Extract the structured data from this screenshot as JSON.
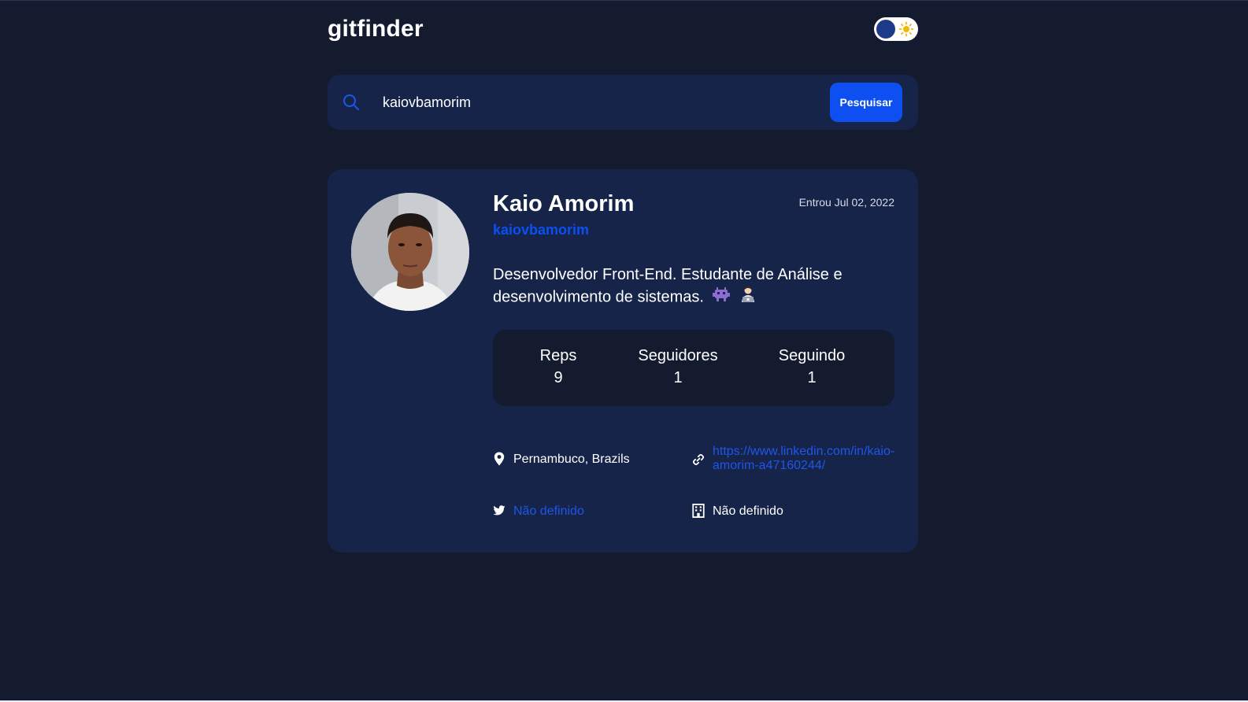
{
  "header": {
    "logo": "gitfinder",
    "theme_toggle": {
      "state": "dark",
      "knob_icon": "moon-knob",
      "sun_icon": "sun-icon"
    }
  },
  "search": {
    "icon": "search-icon",
    "value": "kaiovbamorim",
    "button_label": "Pesquisar"
  },
  "profile": {
    "avatar": "avatar-photo",
    "name": "Kaio Amorim",
    "login": "kaiovbamorim",
    "joined": "Entrou Jul 02, 2022",
    "bio_text": "Desenvolvedor Front-End. Estudante de Análise e desenvolvimento de sistemas.",
    "bio_emojis": [
      "👾",
      "👨🏻‍💻"
    ],
    "stats": {
      "reps_label": "Reps",
      "reps_value": "9",
      "followers_label": "Seguidores",
      "followers_value": "1",
      "following_label": "Seguindo",
      "following_value": "1"
    },
    "info": {
      "location": "Pernambuco, Brazils",
      "website": "https://www.linkedin.com/in/kaio-amorim-a47160244/",
      "twitter": "Não definido",
      "company": "Não definido"
    }
  },
  "colors": {
    "background": "#141b2f",
    "card": "#16244a",
    "accent": "#0d4ff0",
    "link": "#1d56e8",
    "text": "#ffffff"
  }
}
